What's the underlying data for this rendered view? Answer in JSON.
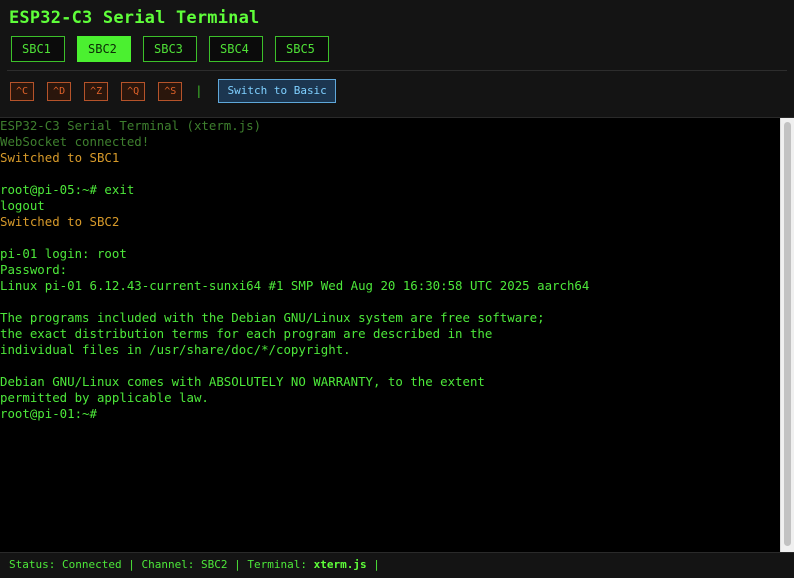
{
  "header": {
    "title": "ESP32-C3 Serial Terminal",
    "tabs": [
      {
        "label": "SBC1",
        "active": false
      },
      {
        "label": "SBC2",
        "active": true
      },
      {
        "label": "SBC3",
        "active": false
      },
      {
        "label": "SBC4",
        "active": false
      },
      {
        "label": "SBC5",
        "active": false
      }
    ],
    "controls": [
      "^C",
      "^D",
      "^Z",
      "^Q",
      "^S"
    ],
    "separator": "|",
    "switch_label": "Switch to Basic"
  },
  "terminal": {
    "lines": [
      {
        "text": "ESP32-C3 Serial Terminal (xterm.js)",
        "style": "dim"
      },
      {
        "text": "WebSocket connected!",
        "style": "dim"
      },
      {
        "text": "Switched to SBC1",
        "style": "orange"
      },
      {
        "text": "",
        "style": "normal"
      },
      {
        "text": "root@pi-05:~# exit",
        "style": "normal"
      },
      {
        "text": "logout",
        "style": "normal"
      },
      {
        "text": "Switched to SBC2",
        "style": "orange"
      },
      {
        "text": "",
        "style": "normal"
      },
      {
        "text": "pi-01 login: root",
        "style": "normal"
      },
      {
        "text": "Password:",
        "style": "normal"
      },
      {
        "text": "Linux pi-01 6.12.43-current-sunxi64 #1 SMP Wed Aug 20 16:30:58 UTC 2025 aarch64",
        "style": "normal"
      },
      {
        "text": "",
        "style": "normal"
      },
      {
        "text": "The programs included with the Debian GNU/Linux system are free software;",
        "style": "normal"
      },
      {
        "text": "the exact distribution terms for each program are described in the",
        "style": "normal"
      },
      {
        "text": "individual files in /usr/share/doc/*/copyright.",
        "style": "normal"
      },
      {
        "text": "",
        "style": "normal"
      },
      {
        "text": "Debian GNU/Linux comes with ABSOLUTELY NO WARRANTY, to the extent",
        "style": "normal"
      },
      {
        "text": "permitted by applicable law.",
        "style": "normal"
      },
      {
        "text": "root@pi-01:~#",
        "style": "normal"
      }
    ]
  },
  "status": {
    "prefix": "Status: Connected | Channel: SBC2 | Terminal: ",
    "terminal_name": "xterm.js",
    "suffix": " |"
  },
  "colors": {
    "accent": "#4bf030",
    "terminal_text": "#4de83a",
    "info_orange": "#d79a2a",
    "control_orange": "#e0622a",
    "switch_blue": "#7fd0ff"
  }
}
